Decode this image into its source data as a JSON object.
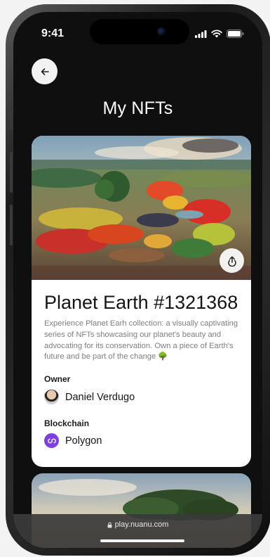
{
  "status": {
    "time": "9:41"
  },
  "header": {
    "title": "My NFTs"
  },
  "nft": {
    "title": "Planet Earth #1321368",
    "description": "Experience Planet Earh collection: a visually captivating series of NFTs showcasing our planet's beauty and advocating for its conservation. Own a piece of Earth's future and be part of the change 🌳",
    "owner_label": "Owner",
    "owner_name": "Daniel Verdugo",
    "blockchain_label": "Blockchain",
    "blockchain_name": "Polygon"
  },
  "browser": {
    "url": "play.nuanu.com"
  },
  "colors": {
    "polygon": "#7f3fe0",
    "card_bg": "#ffffff",
    "screen_bg": "#0f0f0f"
  },
  "icons": [
    "arrow-left-icon",
    "share-icon",
    "lock-icon",
    "signal-icon",
    "wifi-icon",
    "battery-icon"
  ]
}
